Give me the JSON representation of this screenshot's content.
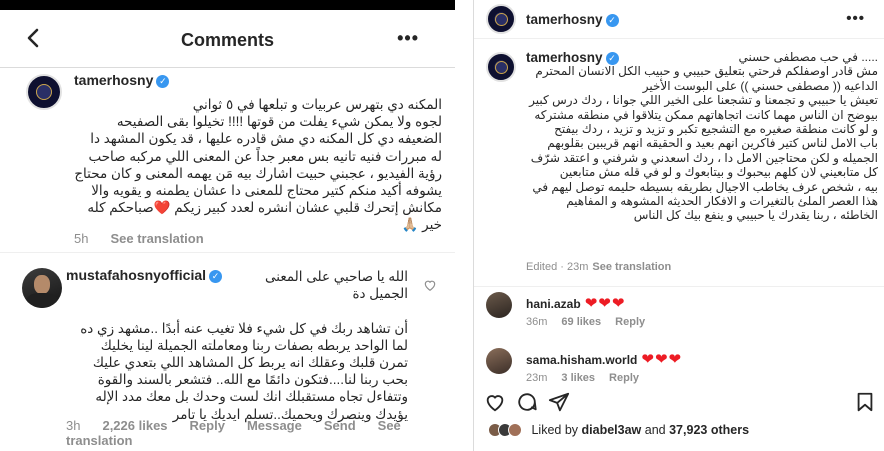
{
  "left": {
    "header": {
      "title": "Comments"
    },
    "comment1": {
      "username": "tamerhosny",
      "text": "المكنه دي بتهرس عربيات و تبلعها في ٥ ثواني\nلجوه  ولا يمكن شيء يفلت من قوتها !!!! تخيلوا بقى الصفيحه\nالضعيفه دي كل المكنه دي مش قادره عليها ، قد يكون المشهد دا\nله مبررات فنيه تانيه بس معبر جداً عن المعنى اللي مركبه صاحب\nرؤية الفيديو ، عجبني حبيت اشارك بيه مَن يهمه المعنى و كان محتاج\nيشوفه  أكيد منكم كتير محتاج للمعنى دا عشان يطمنه و يقويه والا\nمكانش إتحرك قلبي عشان انشره لعدد كبير زيكم ❤️صباحكم كله\nخير 🙏🏼",
      "time": "5h",
      "see_translation": "See translation"
    },
    "comment2": {
      "username": "mustafahosnyofficial",
      "text": "الله يا صاحبي على المعنى\nالجميل دة\n\nأن تشاهد ربك في كل شيء فلا تغيب عنه أبدًا ..مشهد زي ده\nلما الواحد يربطه بصفات ربنا ومعاملته الجميلة لينا يخليك\nتمرن قلبك وعقلك انه يربط كل المشاهد اللي بتعدي عليك\nبحب ربنا لنا....فتكون دائمًا مع الله.. فتشعر بالسند والقوة\nوتتفاءل تجاه مستقبلك انك لست وحدك بل معك مدد الإله\nيؤيدك وينصرك ويحميك..تسلم ايديك يا تامر",
      "time": "3h",
      "likes": "2,226 likes",
      "reply": "Reply",
      "message": "Message",
      "send": "Send",
      "see_translation": "See translation"
    }
  },
  "right": {
    "header": {
      "username": "tamerhosny"
    },
    "caption": {
      "username": "tamerhosny",
      "text": "..... في حب مصطفى حسني\nمش قادر اوصفلكم فرحتي بتعليق حبيبي و حبيب الكل الانسان المحترم\nالداعيه (( مصطفى حسني )) على البوست الأخير\nتعيش يا حبيبي و تجمعنا و تشجعنا على الخير اللي جوانا ، ردك درس كبير\nبيوضح ان الناس مهما كانت اتجاهاتهم ممكن يتلاقوا في منطقه مشتركه\nو لو كانت منطقة صغيره مع التشجيع تكبر و تزيد و تزيد ، ردك بيفتح\nباب الامل لناس كتير فاكرين انهم بعيد و الحقيقه انهم قريبين بقلوبهم\nالجميله و لكن محتاجين الامل دا ، ردك اسعدني و شرفني و اعتقد شرّف\nكل متابعيني لان كلهم بيحبوك و بيتابعوك و لو في قله مش متابعين\nبيه ، شخص عرف يخاطب الاجيال بطريقه بسيطه حليمه توصل ليهم في\nهذا العصر الملئ بالتغيرات و الافكار الحديثه المشوهه و المفاهيم\nالخاطئه ، ربنا يقدرك يا حبيبي و ينفع بيك كل الناس",
      "meta": "Edited · 23m",
      "see_translation": "See translation"
    },
    "comments": [
      {
        "username": "hani.azab",
        "hearts": "❤❤❤",
        "time": "36m",
        "likes": "69 likes",
        "reply": "Reply"
      },
      {
        "username": "sama.hisham.world",
        "hearts": "❤❤❤",
        "time": "23m",
        "likes": "3 likes",
        "reply": "Reply"
      }
    ],
    "likes_prefix": "Liked by",
    "liked_by_user": "diabel3aw",
    "likes_suffix": "and",
    "likes_count": "37,923 others"
  },
  "colors": {
    "verified": "#3897f0",
    "heart": "#ed1c24",
    "meta": "#8e8e8e"
  },
  "icons": [
    "back-arrow-icon",
    "more-icon",
    "verified-icon",
    "heart-outline-icon",
    "comment-icon",
    "share-icon",
    "bookmark-icon"
  ]
}
